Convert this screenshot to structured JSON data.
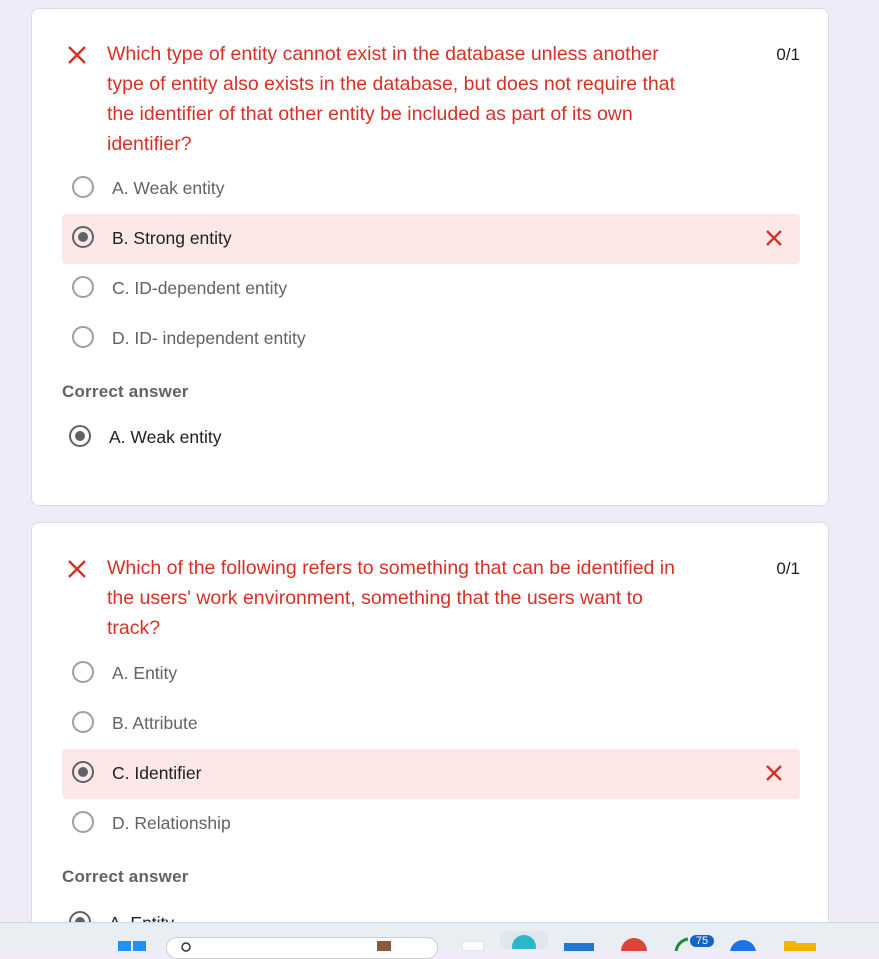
{
  "questions": [
    {
      "text": "Which type of entity cannot exist in the database unless another type of entity also exists in the database, but does not require that the identifier of that other entity be included as part of its own identifier?",
      "score": "0/1",
      "options": [
        "A. Weak entity",
        "B. Strong entity",
        "C. ID-dependent entity",
        "D. ID- independent entity"
      ],
      "correct_title": "Correct answer",
      "correct_answer": "A. Weak entity"
    },
    {
      "text": "Which of the following refers to something that can be identified in the users' work environment, something that the users want to track?",
      "score": "0/1",
      "options": [
        "A. Entity",
        "B. Attribute",
        "C. Identifier",
        "D. Relationship"
      ],
      "correct_title": "Correct answer",
      "correct_answer": "A. Entity"
    }
  ],
  "taskbar": {
    "badge": "75"
  },
  "colors": {
    "wrong": "#d93025",
    "wrong_bg": "#fce8e6",
    "page_bg": "#f0ebf8"
  },
  "icons": [
    "x-mark-icon",
    "radio-icon",
    "windows-start-icon",
    "search-icon",
    "edge-icon",
    "mail-icon",
    "chrome-icon",
    "folder-icon"
  ]
}
